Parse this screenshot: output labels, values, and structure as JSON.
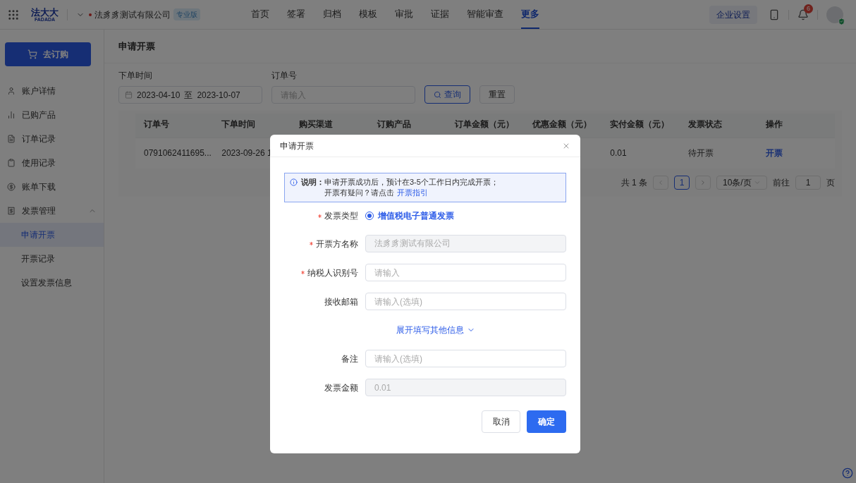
{
  "header": {
    "logo_cn": "法大大",
    "logo_en": "FADADA",
    "company": "法豸豸测试有限公司",
    "edition": "专业版",
    "nav": [
      {
        "label": "首页",
        "selected": false
      },
      {
        "label": "签署",
        "selected": false
      },
      {
        "label": "归档",
        "selected": false
      },
      {
        "label": "模板",
        "selected": false
      },
      {
        "label": "审批",
        "selected": false
      },
      {
        "label": "证据",
        "selected": false
      },
      {
        "label": "智能审查",
        "selected": false
      },
      {
        "label": "更多",
        "selected": true
      }
    ],
    "settings": "企业设置",
    "notifications": "6"
  },
  "sidebar": {
    "order_button": "去订购",
    "items": [
      {
        "label": "账户详情"
      },
      {
        "label": "已购产品"
      },
      {
        "label": "订单记录"
      },
      {
        "label": "使用记录"
      },
      {
        "label": "账单下载"
      },
      {
        "label": "发票管理",
        "expanded": true,
        "children": [
          {
            "label": "申请开票",
            "selected": true
          },
          {
            "label": "开票记录",
            "selected": false
          },
          {
            "label": "设置发票信息",
            "selected": false
          }
        ]
      }
    ]
  },
  "page": {
    "title": "申请开票",
    "filters": {
      "date_label": "下单时间",
      "date_from": "2023-04-10",
      "date_sep": "至",
      "date_to": "2023-10-07",
      "order_label": "订单号",
      "order_placeholder": "请输入",
      "search": "查询",
      "reset": "重置"
    },
    "table": {
      "columns": [
        "订单号",
        "下单时间",
        "购买渠道",
        "订购产品",
        "订单金额（元）",
        "优惠金额（元）",
        "实付金额（元）",
        "发票状态",
        "操作"
      ],
      "rows": [
        {
          "order_no": "0791062411695...",
          "time": "2023-09-26 1",
          "paid": "0.01",
          "status": "待开票",
          "action": "开票"
        }
      ]
    },
    "pagination": {
      "total": "共 1 条",
      "page": "1",
      "page_size": "10条/页",
      "goto": "前往",
      "goto_value": "1",
      "page_unit": "页"
    }
  },
  "dialog": {
    "title": "申请开票",
    "notice_label": "说明：",
    "notice_line1": "申请开票成功后，预计在3-5个工作日内完成开票；",
    "notice_line2": "开票有疑问？请点击",
    "notice_link": "开票指引",
    "invoice_type": {
      "label": "发票类型",
      "required": true,
      "option": "增值税电子普通发票",
      "selected": true
    },
    "fields": [
      {
        "label": "开票方名称",
        "required": true,
        "value": "法豸豸测试有限公司",
        "disabled": true
      },
      {
        "label": "纳税人识别号",
        "required": true,
        "placeholder": "请输入",
        "disabled": false
      },
      {
        "label": "接收邮箱",
        "required": false,
        "placeholder": "请输入(选填)",
        "disabled": false
      }
    ],
    "expand": "展开填写其他信息",
    "fields2": [
      {
        "label": "备注",
        "required": false,
        "placeholder": "请输入(选填)",
        "disabled": false
      },
      {
        "label": "发票金额",
        "required": false,
        "value": "0.01",
        "disabled": true
      }
    ],
    "cancel": "取消",
    "confirm": "确定"
  }
}
